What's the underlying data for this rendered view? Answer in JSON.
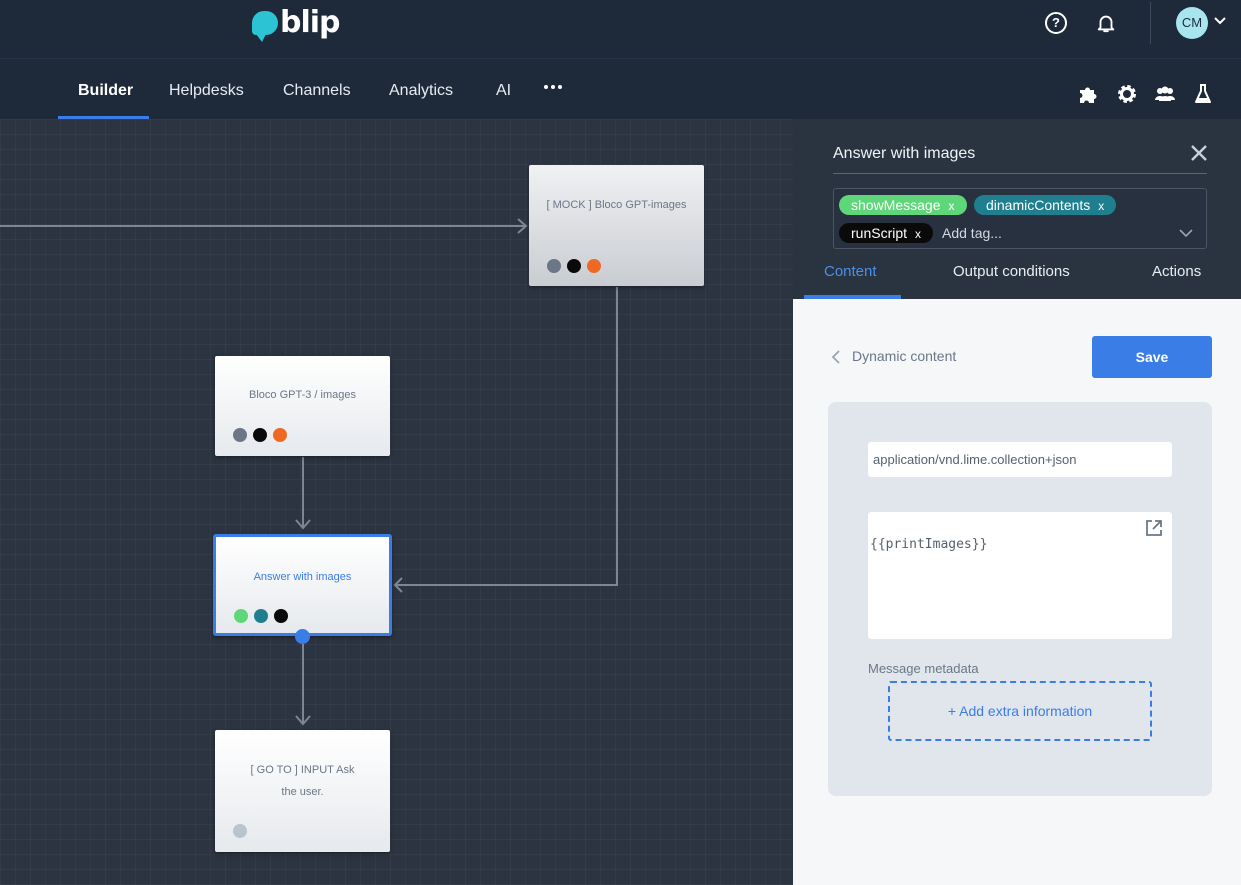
{
  "app": {
    "logo_text": "blip",
    "brand_color": "#2cc3d5",
    "accent_color": "#3b7de6"
  },
  "header": {
    "help_icon": "question-circle-icon",
    "help_glyph": "?",
    "notification_icon": "bell-icon",
    "avatar_initials": "CM"
  },
  "nav": {
    "tabs": [
      {
        "label": "Builder",
        "active": true
      },
      {
        "label": "Helpdesks"
      },
      {
        "label": "Channels"
      },
      {
        "label": "Analytics"
      },
      {
        "label": "AI"
      }
    ],
    "more_icon": "more-dots-icon",
    "right_icons": [
      "puzzle-icon",
      "gear-icon",
      "users-icon",
      "flask-icon"
    ]
  },
  "canvas": {
    "blocks": [
      {
        "title": "[ MOCK ] Bloco GPT-images",
        "dots": [
          "#6b7787",
          "#0a0a0a",
          "#ee6a24"
        ]
      },
      {
        "title": "Bloco GPT-3 / images",
        "dots": [
          "#6b7787",
          "#0a0a0a",
          "#ee6a24"
        ]
      },
      {
        "title": "Answer with images",
        "selected": true,
        "dots": [
          "#5fd67a",
          "#1f7f8f",
          "#0a0a0a"
        ]
      },
      {
        "title": "[ GO TO ] INPUT Ask the user.",
        "dots": [
          "#b9c4cf"
        ]
      }
    ]
  },
  "panel": {
    "title": "Answer with images",
    "tags": [
      {
        "label": "showMessage",
        "remove": "x",
        "color": "#5fd67a"
      },
      {
        "label": "dinamicContents",
        "remove": "x",
        "color": "#1f7f8f"
      },
      {
        "label": "runScript",
        "remove": "x",
        "color": "#0a0a0a"
      }
    ],
    "tag_placeholder": "Add tag...",
    "tabs": [
      {
        "label": "Content",
        "active": true
      },
      {
        "label": "Output conditions"
      },
      {
        "label": "Actions"
      }
    ],
    "back_label": "Dynamic content",
    "save_label": "Save",
    "content_type": "application/vnd.lime.collection+json",
    "content_body": "{{printImages}}",
    "metadata_label": "Message metadata",
    "add_extra_label": "+ Add extra information"
  }
}
